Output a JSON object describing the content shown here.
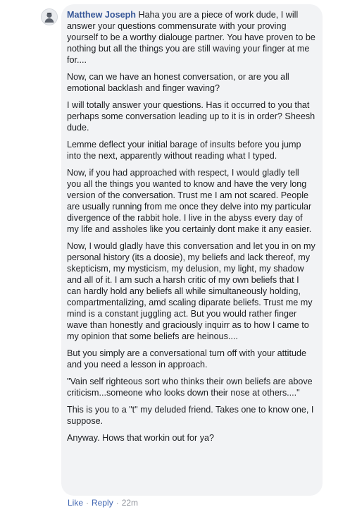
{
  "comment": {
    "author": "Matthew Joseph",
    "paragraphs": [
      " Haha you are a piece of work dude, I will answer your questions commensurate with your proving yourself to be a worthy dialouge partner. You have proven to be nothing but all the things you are still waving your finger at me for....",
      "Now, can we have an honest conversation, or are you all emotional backlash and finger waving?",
      "I will totally answer your questions. Has it occurred to you that perhaps some conversation leading up to it is in order? Sheesh dude.",
      "Lemme deflect your initial barage of insults before you jump into the next, apparently without reading what I typed.",
      "Now, if you had approached with respect, I would gladly tell you all the things you wanted to know and have the very long version of the conversation. Trust me I am not scared. People are usually running from me once they delve into my particular divergence of the rabbit hole. I live in the abyss every day of my life and assholes like you certainly dont make it any easier.",
      "Now, I would gladly have this conversation and let you in on my personal history (its a doosie), my beliefs and lack thereof, my skepticism, my mysticism, my delusion, my light, my shadow and all of it. I am such a harsh critic of my own beliefs that I can hardly hold any beliefs all while simultaneously holding, compartmentalizing, amd scaling diparate beliefs. Trust me my mind is a constant juggling act. But you would rather finger wave than honestly and graciously inquirr as to how I came to my opinion that some beliefs are heinous....",
      "But you simply are a conversational turn off with your attitude and you need a lesson in approach.",
      "\"Vain self righteous sort who thinks their own beliefs are above criticism...someone who looks down their nose at others....\"",
      "This is you to a \"t\" my deluded friend. Takes one to know one, I suppose.",
      "Anyway. Hows that workin out for ya?"
    ],
    "actions": {
      "like": "Like",
      "separator": "·",
      "reply": "Reply",
      "time": "22m"
    }
  },
  "colors": {
    "bubble": "#f2f3f5",
    "author": "#385898",
    "link": "#4267b2",
    "meta": "#90949c"
  },
  "icons": {
    "avatar": "avatar-icon"
  }
}
